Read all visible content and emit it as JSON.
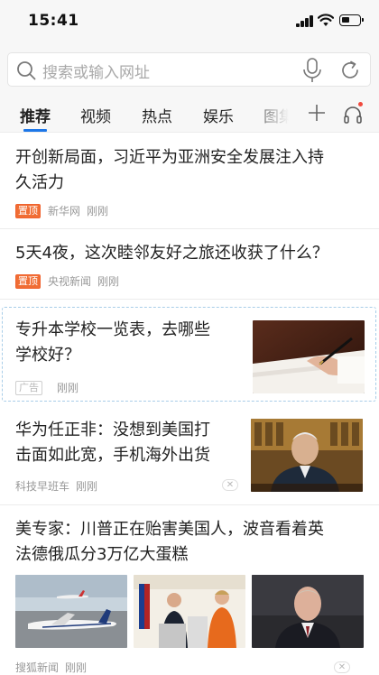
{
  "status_bar": {
    "time": "15:41"
  },
  "search": {
    "placeholder": "搜索或输入网址"
  },
  "tabs": [
    {
      "label": "推荐",
      "active": true
    },
    {
      "label": "视频"
    },
    {
      "label": "热点"
    },
    {
      "label": "娱乐"
    },
    {
      "label": "图集"
    }
  ],
  "feed": [
    {
      "title_line1": "开创新局面，习近平为亚洲安全发展注入持",
      "title_line2": "久活力",
      "tag": "置顶",
      "source": "新华网",
      "time": "刚刚"
    },
    {
      "title_line1": "5天4夜，这次睦邻友好之旅还收获了什么？",
      "tag": "置顶",
      "source": "央视新闻",
      "time": "刚刚"
    },
    {
      "title_line1": "专升本学校一览表，去哪些",
      "title_line2": "学校好？",
      "ad_label": "广告",
      "time": "刚刚"
    },
    {
      "title_line1": "华为任正非：没想到美国打",
      "title_line2": "击面如此宽，手机海外出货",
      "source": "科技早班车",
      "time": "刚刚"
    },
    {
      "title_line1": "美专家：川普正在贻害美国人，波音看着英",
      "title_line2": "法德俄瓜分3万亿大蛋糕",
      "source": "搜狐新闻",
      "time": "刚刚"
    }
  ],
  "colors": {
    "accent": "#1d77e8",
    "tag_bg": "#f06d34",
    "notification_dot": "#f04a3e"
  },
  "icons": [
    "signal-icon",
    "wifi-icon",
    "battery-icon",
    "search-icon",
    "microphone-icon",
    "refresh-icon",
    "plus-icon",
    "headphones-icon",
    "close-icon"
  ]
}
